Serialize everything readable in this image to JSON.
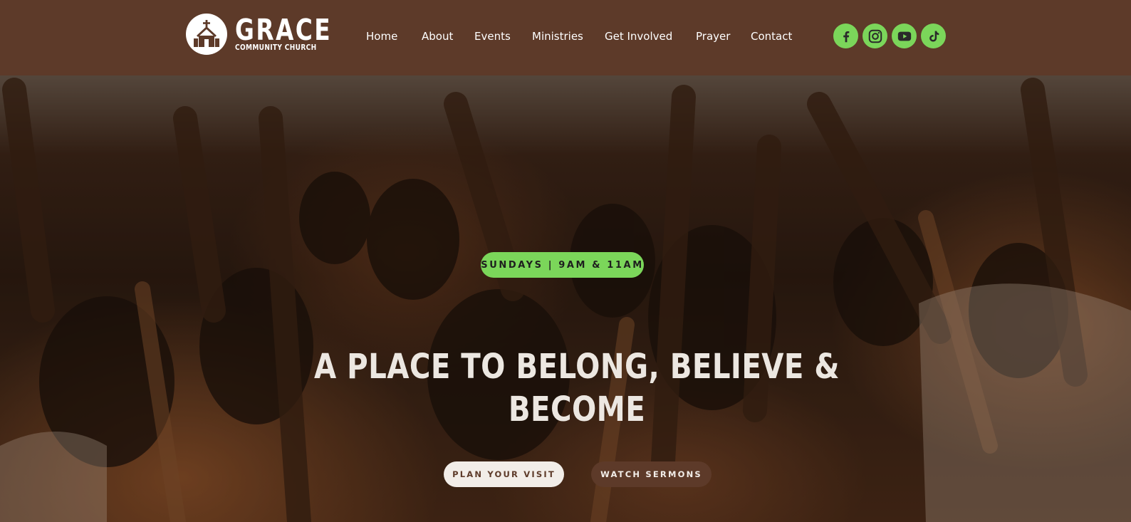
{
  "brand": {
    "name": "GRACE",
    "subtitle": "COMMUNITY CHURCH",
    "logo_icon": "church-icon"
  },
  "nav": {
    "items": [
      {
        "label": "Home"
      },
      {
        "label": "About"
      },
      {
        "label": "Events"
      },
      {
        "label": "Ministries"
      },
      {
        "label": "Get Involved"
      },
      {
        "label": "Prayer"
      },
      {
        "label": "Contact"
      }
    ]
  },
  "social": {
    "items": [
      "facebook-icon",
      "instagram-icon",
      "youtube-icon",
      "tiktok-icon"
    ]
  },
  "hero": {
    "badge": "SUNDAYS | 9AM & 11AM",
    "headline": "A PLACE TO BELONG, BELIEVE & BECOME",
    "primary_button": "PLAN YOUR VISIT",
    "secondary_button": "WATCH SERMONS"
  },
  "colors": {
    "header_bg": "#5d3a29",
    "accent_green": "#7bd65a",
    "button_light": "#f2ede8",
    "button_dark": "#5d3a29"
  }
}
